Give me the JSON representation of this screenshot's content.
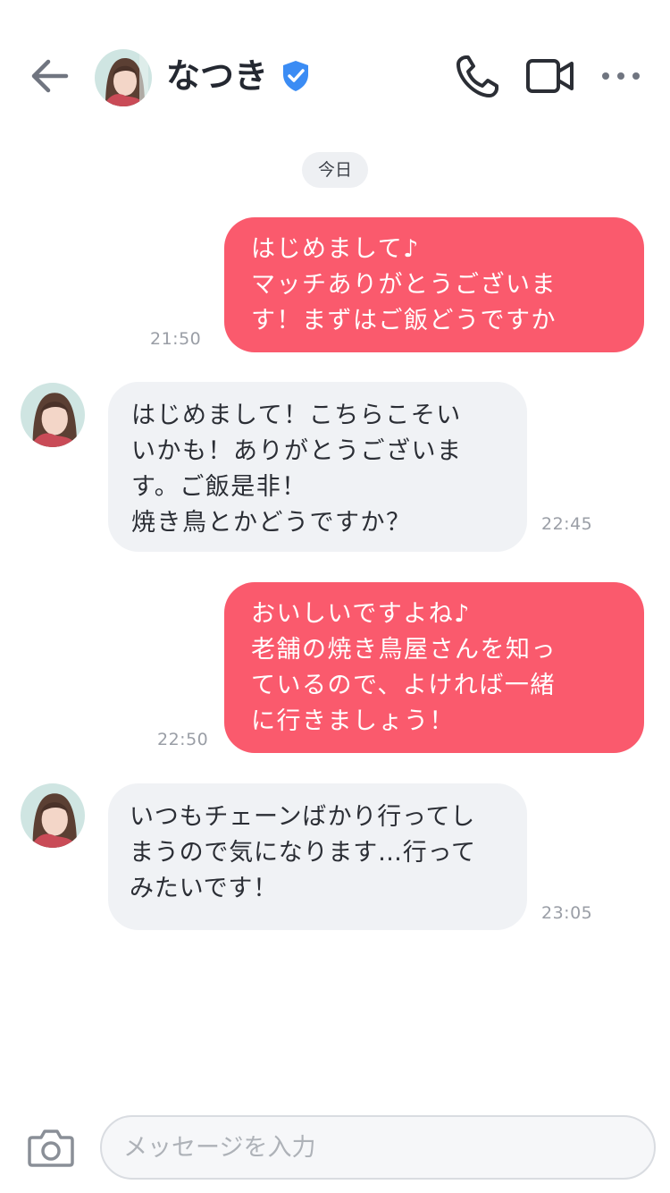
{
  "header": {
    "name": "なつき",
    "icons": [
      "back-arrow-icon",
      "avatar",
      "verified-badge-icon",
      "phone-icon",
      "video-icon",
      "more-icon"
    ]
  },
  "date_divider": "今日",
  "messages": [
    {
      "direction": "sent",
      "text": "はじめまして♪\nマッチありがとうございま\nす！まずはご飯どうですか",
      "time": "21:50"
    },
    {
      "direction": "received",
      "text": "はじめまして！こちらこそい\nいかも！ありがとうございま\nす。ご飯是非！\n焼き鳥とかどうですか？",
      "time": "22:45"
    },
    {
      "direction": "sent",
      "text": "おいしいですよね♪\n老舗の焼き鳥屋さんを知っ\nているので、よければ一緒\nに行きましょう！",
      "time": "22:50"
    },
    {
      "direction": "received",
      "text": "いつもチェーンばかり行ってし\nまうので気になります…行って\nみたいです！",
      "time": "23:05"
    }
  ],
  "composer": {
    "placeholder": "メッセージを入力",
    "value": "",
    "icons": [
      "camera-icon"
    ]
  },
  "colors": {
    "sent_bubble": "#fa5a6d",
    "received_bubble": "#f0f2f5",
    "verified": "#3b8cf4",
    "icon": "#2b2e35"
  }
}
